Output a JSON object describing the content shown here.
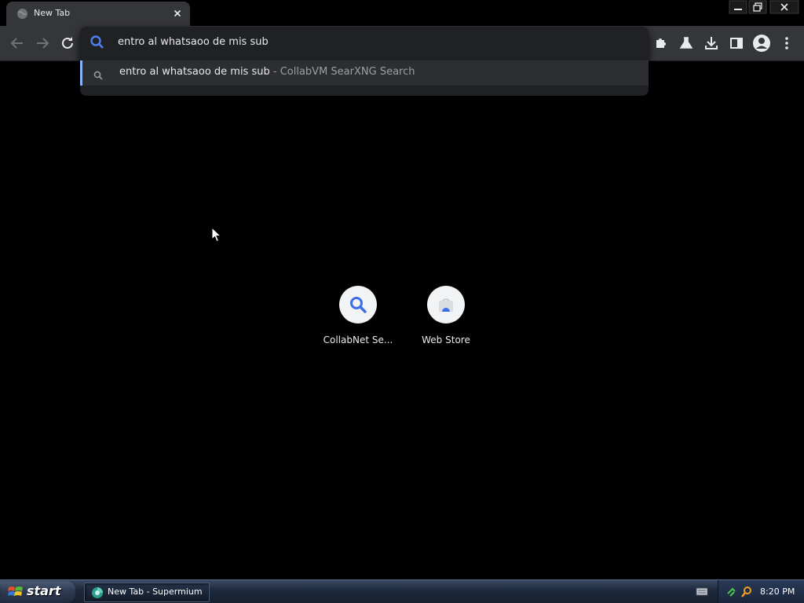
{
  "tab": {
    "title": "New Tab",
    "favicon": "globe-icon",
    "close_icon": "close-icon"
  },
  "window_controls": {
    "minimize": "minimize-icon",
    "restore": "restore-icon",
    "close": "close-icon"
  },
  "toolbar": {
    "back": "back-arrow-icon",
    "forward": "forward-arrow-icon",
    "reload": "reload-icon",
    "extensions": "puzzle-icon",
    "labs": "flask-icon",
    "downloads": "download-icon",
    "side_panel": "side-panel-icon",
    "profile": "profile-avatar-icon",
    "menu": "kebab-menu-icon"
  },
  "omnibox": {
    "value": "entro al whatsaoo de mis sub",
    "suggestion": {
      "query": "entro al whatsaoo de mis sub",
      "separator": " - ",
      "engine": "CollabVM SearXNG Search"
    }
  },
  "shortcuts": [
    {
      "label": "CollabNet Se...",
      "icon": "magnifier-icon"
    },
    {
      "label": "Web Store",
      "icon": "web-store-icon"
    }
  ],
  "taskbar": {
    "start_label": "start",
    "task_label": "New Tab - Supermium",
    "clock": "8:20 PM"
  },
  "colors": {
    "accent": "#8ab4f8",
    "toolbar": "#35363a",
    "omnibox": "#202124",
    "page": "#000000"
  }
}
